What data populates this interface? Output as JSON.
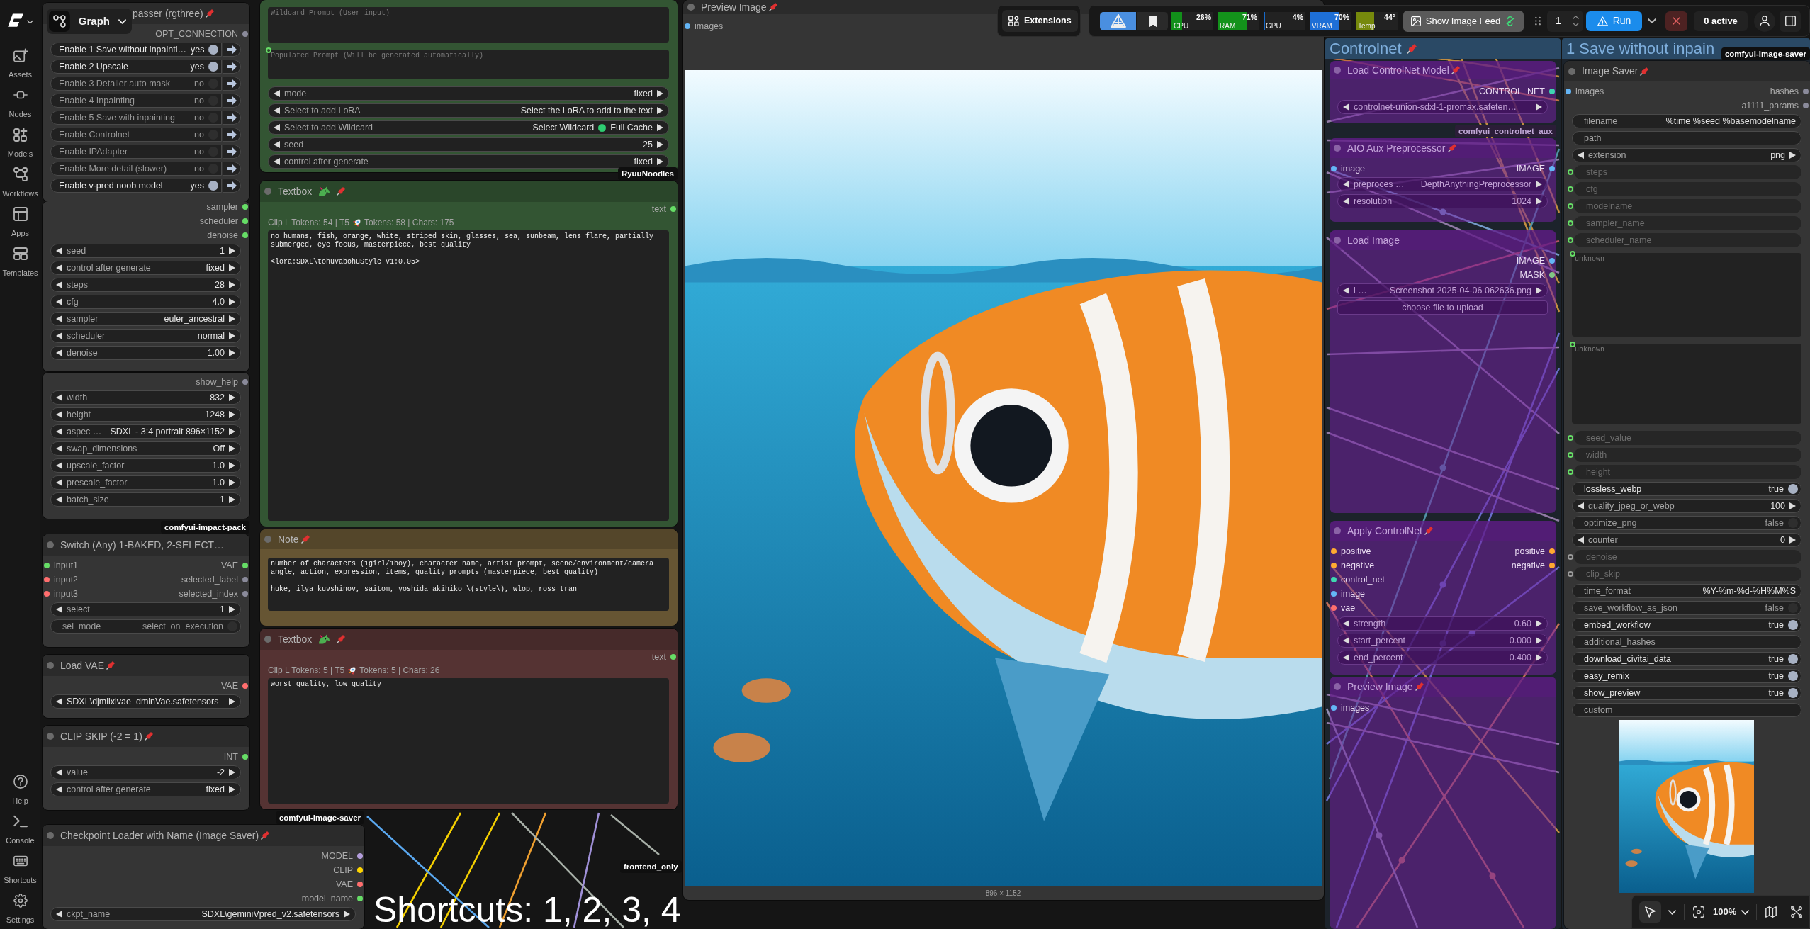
{
  "sidebar": {
    "items": [
      {
        "label": "Assets",
        "selected": false
      },
      {
        "label": "Nodes",
        "selected": false
      },
      {
        "label": "Models",
        "selected": false
      },
      {
        "label": "Workflows",
        "selected": false
      },
      {
        "label": "Apps",
        "selected": false
      },
      {
        "label": "Templates",
        "selected": false
      }
    ],
    "bottom_items": [
      {
        "label": "Help",
        "selected": false
      },
      {
        "label": "Console",
        "selected": false
      },
      {
        "label": "Shortcuts",
        "selected": false
      },
      {
        "label": "Settings",
        "selected": false
      }
    ]
  },
  "graph_menu": {
    "label": "Graph"
  },
  "extensions_button": {
    "label": "Extensions"
  },
  "actionbar": {
    "toggles": [
      {
        "selected": true
      },
      {
        "selected": false
      }
    ],
    "monitors": [
      {
        "label": "CPU",
        "reading": "26%",
        "level": 0.26,
        "color": "#12901a"
      },
      {
        "label": "RAM",
        "reading": "71%",
        "level": 0.71,
        "color": "#13921b"
      },
      {
        "label": "GPU",
        "reading": "4%",
        "level": 0.04,
        "color": "#1668c8"
      },
      {
        "label": "VRAM",
        "reading": "70%",
        "level": 0.7,
        "color": "#1e6fd6"
      },
      {
        "label": "Temp",
        "reading": "44°",
        "level": 0.44,
        "color": "#76890c"
      }
    ],
    "feed_button": {
      "label": "Show Image Feed"
    },
    "queue": {
      "value": "1"
    },
    "run_button": {
      "label": "Run"
    },
    "active_button": {
      "label": "0 active"
    }
  },
  "groups": [
    {
      "title": "Controlnet",
      "pinned": true
    },
    {
      "title": "1 Save without inpain"
    }
  ],
  "nodes": [
    {
      "kind": "node",
      "title": "passer (rgthree)",
      "pinned": true,
      "bypassed": false,
      "color": "#353535",
      "rows": [
        {
          "kind": "slots",
          "output": {
            "label": "OPT_CONNECTION",
            "color": "#8a8a9a"
          }
        },
        {
          "kind": "group-toggle",
          "label": "Enable 1 Save without inpainti…",
          "value": "yes",
          "on": true
        },
        {
          "kind": "group-toggle",
          "label": "Enable 2 Upscale",
          "value": "yes",
          "on": true
        },
        {
          "kind": "group-toggle",
          "label": "Enable 3 Detailer auto mask",
          "value": "no",
          "on": false
        },
        {
          "kind": "group-toggle",
          "label": "Enable 4 Inpainting",
          "value": "no",
          "on": false
        },
        {
          "kind": "group-toggle",
          "label": "Enable 5 Save with inpainting",
          "value": "no",
          "on": false
        },
        {
          "kind": "group-toggle",
          "label": "Enable Controlnet",
          "value": "no",
          "on": false
        },
        {
          "kind": "group-toggle",
          "label": "Enable IPAdapter",
          "value": "no",
          "on": false
        },
        {
          "kind": "group-toggle",
          "label": "Enable More detail (slower)",
          "value": "no",
          "on": false
        },
        {
          "kind": "group-toggle",
          "label": "Enable v-pred noob model",
          "value": "yes",
          "on": true
        }
      ]
    },
    {
      "bypassed": false,
      "color": "#353535",
      "rows": [
        {
          "kind": "slots",
          "output": {
            "label": "sampler",
            "color": "#66dd66"
          }
        },
        {
          "kind": "slots",
          "output": {
            "label": "scheduler",
            "color": "#66dd66"
          }
        },
        {
          "kind": "slots",
          "output": {
            "label": "denoise",
            "color": "#66dd66"
          }
        },
        {
          "kind": "stepper",
          "label": "seed",
          "value": "1"
        },
        {
          "kind": "stepper",
          "label": "control after generate",
          "value": "fixed"
        },
        {
          "kind": "stepper",
          "label": "steps",
          "value": "28"
        },
        {
          "kind": "stepper",
          "label": "cfg",
          "value": "4.0"
        },
        {
          "kind": "stepper",
          "label": "sampler",
          "value": "euler_ancestral"
        },
        {
          "kind": "stepper",
          "label": "scheduler",
          "value": "normal"
        },
        {
          "kind": "stepper",
          "label": "denoise",
          "value": "1.00"
        }
      ]
    },
    {
      "bypassed": false,
      "color": "#353535",
      "rows": [
        {
          "kind": "slots",
          "output": {
            "label": "show_help",
            "color": "#8a8a9a"
          }
        },
        {
          "kind": "stepper",
          "label": "width",
          "value": "832"
        },
        {
          "kind": "stepper",
          "label": "height",
          "value": "1248"
        },
        {
          "kind": "stepper",
          "label": "aspec …",
          "value": "SDXL - 3:4 portrait 896×1152"
        },
        {
          "kind": "stepper",
          "label": "swap_dimensions",
          "value": "Off"
        },
        {
          "kind": "stepper",
          "label": "upscale_factor",
          "value": "1.0"
        },
        {
          "kind": "stepper",
          "label": "prescale_factor",
          "value": "1.0"
        },
        {
          "kind": "stepper",
          "label": "batch_size",
          "value": "1"
        }
      ]
    },
    {
      "kind": "node",
      "title": "Switch (Any) 1-BAKED, 2-SELECT…",
      "pinned": false,
      "bypassed": false,
      "color": "#353535",
      "badge": "comfyui-impact-pack",
      "rows": [
        {
          "kind": "slots",
          "input": {
            "label": "input1",
            "color": "#66dd66"
          },
          "output": {
            "label": "VAE",
            "color": "#66dd66"
          }
        },
        {
          "kind": "slots",
          "input": {
            "label": "input2",
            "color": "#ff6e6e"
          },
          "output": {
            "label": "selected_label",
            "color": "#8a8a9a"
          }
        },
        {
          "kind": "slots",
          "input": {
            "label": "input3",
            "color": "#ff6e6e"
          },
          "output": {
            "label": "selected_index",
            "color": "#8a8a9a"
          }
        },
        {
          "kind": "stepper",
          "label": "select",
          "value": "1"
        },
        {
          "kind": "toggle",
          "label": "sel_mode",
          "value": "select_on_execution",
          "on": false
        }
      ]
    },
    {
      "kind": "node",
      "title": "Load VAE",
      "pinned": true,
      "bypassed": false,
      "color": "#353535",
      "rows": [
        {
          "kind": "slots",
          "output": {
            "label": "VAE",
            "color": "#ff6e6e"
          }
        },
        {
          "kind": "stepper",
          "value": "SDXL\\djmilxlvae_dminVae.safetensors"
        }
      ]
    },
    {
      "kind": "node",
      "title": "CLIP SKIP (-2 = 1)",
      "pinned": true,
      "bypassed": false,
      "color": "#353535",
      "rows": [
        {
          "kind": "slots",
          "output": {
            "label": "INT",
            "color": "#66dd66"
          }
        },
        {
          "kind": "stepper",
          "label": "value",
          "value": "-2"
        },
        {
          "kind": "stepper",
          "label": "control after generate",
          "value": "fixed"
        }
      ]
    },
    {
      "kind": "node",
      "title": "Checkpoint Loader with Name (Image Saver)",
      "pinned": true,
      "bypassed": false,
      "color": "#353535",
      "badge": "comfyui-image-saver",
      "rows": [
        {
          "kind": "slots",
          "output": {
            "label": "MODEL",
            "color": "#b39ddb"
          }
        },
        {
          "kind": "slots",
          "output": {
            "label": "CLIP",
            "color": "#ffd500"
          }
        },
        {
          "kind": "slots",
          "output": {
            "label": "VAE",
            "color": "#ff6e6e"
          }
        },
        {
          "kind": "slots",
          "output": {
            "label": "model_name",
            "color": "#66dd66"
          }
        },
        {
          "kind": "stepper",
          "label": "ckpt_name",
          "value": "SDXL\\geminiVpred_v2.safetensors"
        }
      ]
    },
    {
      "bypassed": false,
      "color": "#335533",
      "rows": [
        {
          "kind": "textarea",
          "placeholder": "Wildcard Prompt (User input)"
        },
        {
          "kind": "textarea",
          "placeholder": "Populated Prompt (Will be generated automatically)",
          "color": "#66dd66"
        },
        {
          "kind": "stepper",
          "label": "mode",
          "value": "fixed"
        },
        {
          "kind": "stepper",
          "label": "Select to add LoRA",
          "value": "Select the LoRA to add to the text"
        },
        {
          "kind": "stepper",
          "label": "Select to add Wildcard",
          "value": "Select Wildcard",
          "status": "Full Cache"
        },
        {
          "kind": "stepper",
          "label": "seed",
          "value": "25"
        },
        {
          "kind": "stepper",
          "label": "control after generate",
          "value": "fixed"
        }
      ]
    },
    {
      "kind": "textbox",
      "title": "Textbox",
      "pinned": true,
      "bypassed": false,
      "color": "#335533",
      "badge": "RyuuNoodles",
      "rows": [
        {
          "kind": "slots",
          "output": {
            "label": "text",
            "color": "#66dd66"
          }
        },
        {
          "kind": "stats",
          "before": "Clip L Tokens: 54 | T5",
          "after": "Tokens: 58 | Chars: 175"
        },
        {
          "kind": "textarea",
          "value": "no humans, fish, orange, white, striped skin, glasses, sea, sunbeam, lens flare, partially submerged, eye focus, masterpiece, best quality\n\n<lora:SDXL\\tohuvabohuStyle_v1:0.05>"
        }
      ]
    },
    {
      "kind": "node",
      "title": "Note",
      "pinned": true,
      "bypassed": false,
      "color": "#665533",
      "rows": [
        {
          "kind": "textarea",
          "value": "number of characters (1girl/1boy), character name, artist prompt, scene/environment/camera angle, action, expression, items, quality prompts (masterpiece, best quality)\n\nhuke, ilya kuvshinov, saitom, yoshida akihiko \\(style\\), wlop, ross tran"
        }
      ]
    },
    {
      "kind": "textbox",
      "title": "Textbox",
      "pinned": true,
      "bypassed": false,
      "color": "#553333",
      "rows": [
        {
          "kind": "slots",
          "output": {
            "label": "text",
            "color": "#66dd66"
          }
        },
        {
          "kind": "stats",
          "before": "Clip L Tokens: 5 | T5",
          "after": "Tokens: 5 | Chars: 26"
        },
        {
          "kind": "textarea",
          "value": "worst quality, low quality"
        }
      ]
    },
    {
      "kind": "node",
      "title": "Preview Image",
      "pinned": true,
      "bypassed": false,
      "color": "#353535",
      "rows": [
        {
          "kind": "slots",
          "input": {
            "label": "images",
            "color": "#64b5f6"
          }
        },
        {
          "kind": "image",
          "caption": "896 × 1152"
        }
      ]
    },
    {
      "kind": "node",
      "title": "Load ControlNet Model",
      "pinned": true,
      "bypassed": true,
      "rows": [
        {
          "kind": "slots",
          "output": {
            "label": "CONTROL_NET",
            "color": "#3fd6b0"
          }
        },
        {
          "kind": "stepper",
          "value": "controlnet-union-sdxl-1-promax.safeten…"
        }
      ]
    },
    {
      "kind": "node",
      "title": "AIO Aux Preprocessor",
      "pinned": true,
      "bypassed": true,
      "badge": "comfyui_controlnet_aux",
      "rows": [
        {
          "kind": "slots",
          "input": {
            "label": "image",
            "color": "#64b5f6"
          },
          "output": {
            "label": "IMAGE",
            "color": "#64b5f6"
          }
        },
        {
          "kind": "stepper",
          "label": "preproces …",
          "value": "DepthAnythingPreprocessor"
        },
        {
          "kind": "stepper",
          "label": "resolution",
          "value": "1024"
        }
      ]
    },
    {
      "kind": "node",
      "title": "Load Image",
      "pinned": false,
      "bypassed": true,
      "rows": [
        {
          "kind": "slots",
          "output": {
            "label": "IMAGE",
            "color": "#64b5f6"
          }
        },
        {
          "kind": "slots",
          "output": {
            "label": "MASK",
            "color": "#81c784"
          }
        },
        {
          "kind": "stepper",
          "label": "i …",
          "value": "Screenshot 2025-04-06 062636.png"
        },
        {
          "kind": "button",
          "label": "choose file to upload"
        }
      ]
    },
    {
      "kind": "node",
      "title": "Apply ControlNet",
      "pinned": true,
      "bypassed": true,
      "rows": [
        {
          "kind": "slots",
          "input": {
            "label": "positive",
            "color": "#ffa931"
          },
          "output": {
            "label": "positive",
            "color": "#ffa931"
          }
        },
        {
          "kind": "slots",
          "input": {
            "label": "negative",
            "color": "#ffa931"
          },
          "output": {
            "label": "negative",
            "color": "#ffa931"
          }
        },
        {
          "kind": "slots",
          "input": {
            "label": "control_net",
            "color": "#3fd6b0"
          }
        },
        {
          "kind": "slots",
          "input": {
            "label": "image",
            "color": "#64b5f6"
          }
        },
        {
          "kind": "slots",
          "input": {
            "label": "vae",
            "color": "#ff6e6e"
          }
        },
        {
          "kind": "stepper",
          "label": "strength",
          "value": "0.60"
        },
        {
          "kind": "stepper",
          "label": "start_percent",
          "value": "0.000"
        },
        {
          "kind": "stepper",
          "label": "end_percent",
          "value": "0.400"
        }
      ]
    },
    {
      "kind": "node",
      "title": "Preview Image",
      "pinned": true,
      "bypassed": true,
      "rows": [
        {
          "kind": "slots",
          "input": {
            "label": "images",
            "color": "#64b5f6"
          }
        }
      ]
    },
    {
      "kind": "node",
      "title": "Image Saver",
      "pinned": true,
      "bypassed": false,
      "color": "#353535",
      "badge": "comfyui-image-saver",
      "rows": [
        {
          "kind": "slots",
          "input": {
            "label": "images",
            "color": "#64b5f6"
          },
          "output": {
            "label": "hashes",
            "color": "#8a8a9a"
          }
        },
        {
          "kind": "slots",
          "output": {
            "label": "a1111_params",
            "color": "#8a8a9a"
          }
        },
        {
          "kind": "text",
          "label": "filename",
          "value": "%time %seed %basemodelname"
        },
        {
          "kind": "text",
          "label": "path"
        },
        {
          "kind": "stepper",
          "label": "extension",
          "value": "png"
        },
        {
          "kind": "input",
          "label": "steps",
          "color": "#66dd66"
        },
        {
          "kind": "input",
          "label": "cfg",
          "color": "#66dd66"
        },
        {
          "kind": "input",
          "label": "modelname",
          "color": "#66dd66"
        },
        {
          "kind": "input",
          "label": "sampler_name",
          "color": "#66dd66"
        },
        {
          "kind": "input",
          "label": "scheduler_name",
          "color": "#66dd66"
        },
        {
          "kind": "textarea",
          "placeholder": "unknown",
          "color": "#66dd66"
        },
        {
          "kind": "textarea",
          "placeholder": "unknown",
          "color": "#66dd66"
        },
        {
          "kind": "input",
          "label": "seed_value",
          "color": "#66dd66"
        },
        {
          "kind": "input",
          "label": "width",
          "color": "#66dd66"
        },
        {
          "kind": "input",
          "label": "height",
          "color": "#66dd66"
        },
        {
          "kind": "toggle",
          "label": "lossless_webp",
          "value": "true",
          "on": true
        },
        {
          "kind": "stepper",
          "label": "quality_jpeg_or_webp",
          "value": "100"
        },
        {
          "kind": "toggle",
          "label": "optimize_png",
          "value": "false",
          "on": false
        },
        {
          "kind": "stepper",
          "label": "counter",
          "value": "0"
        },
        {
          "kind": "input",
          "label": "denoise",
          "color": "#9a9a9a"
        },
        {
          "kind": "input",
          "label": "clip_skip",
          "color": "#9a9a9a"
        },
        {
          "kind": "text",
          "label": "time_format",
          "value": "%Y-%m-%d-%H%M%S"
        },
        {
          "kind": "toggle",
          "label": "save_workflow_as_json",
          "value": "false",
          "on": false
        },
        {
          "kind": "toggle",
          "label": "embed_workflow",
          "value": "true",
          "on": true
        },
        {
          "kind": "text",
          "label": "additional_hashes"
        },
        {
          "kind": "toggle",
          "label": "download_civitai_data",
          "value": "true",
          "on": true
        },
        {
          "kind": "toggle",
          "label": "easy_remix",
          "value": "true",
          "on": true
        },
        {
          "kind": "toggle",
          "label": "show_preview",
          "value": "true",
          "on": true
        },
        {
          "kind": "text",
          "label": "custom"
        },
        {
          "kind": "image"
        }
      ]
    }
  ],
  "canvas_badges": [
    {
      "label": "frontend_only"
    }
  ],
  "overlay_text": "Shortcuts: 1, 2, 3, 4",
  "canvas_toolbar": {
    "select_tool": {
      "selected": true
    },
    "zoom": "100%"
  }
}
